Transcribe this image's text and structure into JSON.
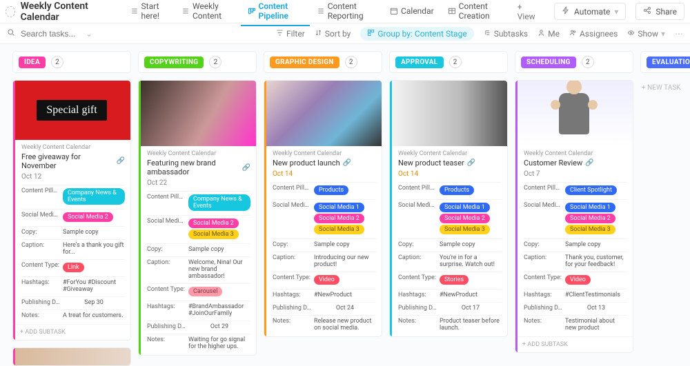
{
  "header": {
    "title": "Weekly Content Calendar",
    "views": [
      "Start here!",
      "Weekly Content",
      "Content Pipeline",
      "Content Reporting",
      "Calendar",
      "Content Creation"
    ],
    "add_view": "+ View",
    "automate": "Automate",
    "share": "Share"
  },
  "filterbar": {
    "search_placeholder": "Search tasks...",
    "filter": "Filter",
    "sort": "Sort by",
    "group": "Group by: Content Stage",
    "subtasks": "Subtasks",
    "me": "Me",
    "assignees": "Assignees",
    "show": "Show"
  },
  "colors": {
    "idea": "#ff3ea5",
    "copywriting": "#54d21a",
    "graphic": "#ff9a1f",
    "approval": "#17c7e0",
    "scheduling": "#b15cff",
    "evaluation": "#4a6cff",
    "pillar_news": "#17c7e0",
    "pillar_products": "#2f6af5",
    "pillar_spotlight": "#2f6af5",
    "sm1": "#2f6af5",
    "sm2": "#ff3ea5",
    "sm3": "#ffd11a",
    "link": "#ff4d64",
    "carousel": "#ff9aa8",
    "video": "#ff4d64",
    "stories": "#ff4d64"
  },
  "stages": [
    {
      "name": "IDEA",
      "color_key": "idea",
      "count": 2
    },
    {
      "name": "COPYWRITING",
      "color_key": "copywriting",
      "count": 2
    },
    {
      "name": "GRAPHIC DESIGN",
      "color_key": "graphic",
      "count": 2
    },
    {
      "name": "APPROVAL",
      "color_key": "approval",
      "count": 2
    },
    {
      "name": "SCHEDULING",
      "color_key": "scheduling",
      "count": 2
    },
    {
      "name": "EVALUATION",
      "color_key": "evaluation",
      "count": 0
    }
  ],
  "new_task": "+ NEW TASK",
  "add_subtask": "+ ADD SUBTASK",
  "category_label": "Weekly Content Calendar",
  "field_labels": {
    "pillar": "Content Pillar:",
    "social": "Social Media...",
    "copy": "Copy:",
    "caption": "Caption:",
    "ctype": "Content Type:",
    "hashtags": "Hashtags:",
    "pub": "Publishing D...",
    "notes": "Notes:"
  },
  "cards": {
    "c0": {
      "title": "Free giveaway for November",
      "date": "Oct 12",
      "pillar": "Company News & Events",
      "pillar_color": "pillar_news",
      "social": [
        "sm2"
      ],
      "social_labels": [
        "Social Media 2"
      ],
      "copy": "Sample copy",
      "caption": "Here's a thank you gift for...",
      "ctype": "Link",
      "ctype_color": "link",
      "hashtags": "#ForYou #Discount #Giveaway",
      "pub": "Sep 30",
      "notes": "A treat for customers."
    },
    "c1": {
      "title": "Featuring new brand ambassador",
      "date": "Oct 22",
      "pillar": "Company News & Events",
      "pillar_color": "pillar_news",
      "social": [
        "sm2",
        "sm3"
      ],
      "social_labels": [
        "Social Media 2",
        "Social Media 3"
      ],
      "copy": "Sample copy",
      "caption": "Welcome, Nina! Our new brand ambassador!",
      "ctype": "Carousel",
      "ctype_color": "carousel",
      "hashtags": "#BrandAmbassador #JoinOurFamily",
      "pub": "Oct 29",
      "notes": "Waiting for go signal for the higher ups."
    },
    "c2": {
      "title": "New product launch",
      "date": "Oct 14",
      "pillar": "Products",
      "pillar_color": "pillar_products",
      "social": [
        "sm1",
        "sm2",
        "sm3"
      ],
      "social_labels": [
        "Social Media 1",
        "Social Media 2",
        "Social Media 3"
      ],
      "copy": "Sample copy",
      "caption": "Introducing our new product!",
      "ctype": "Video",
      "ctype_color": "video",
      "hashtags": "#NewProduct",
      "pub": "Oct 24",
      "notes": "Release new product on social media."
    },
    "c3": {
      "title": "New product teaser",
      "date": "Oct 14",
      "pillar": "Products",
      "pillar_color": "pillar_products",
      "social": [
        "sm1",
        "sm2",
        "sm3"
      ],
      "social_labels": [
        "Social Media 1",
        "Social Media 2",
        "Social Media 3"
      ],
      "copy": "Sample copy",
      "caption": "You're in for a surprise. Watch out!",
      "ctype": "Stories",
      "ctype_color": "stories",
      "hashtags": "#NewProduct",
      "pub": "Oct 17",
      "notes": "Product teaser before launch."
    },
    "c4": {
      "title": "Customer Review",
      "date": "Oct 7",
      "pillar": "Client Spotlight",
      "pillar_color": "pillar_spotlight",
      "social": [
        "sm1",
        "sm2",
        "sm3"
      ],
      "social_labels": [
        "Social Media 1",
        "Social Media 2",
        "Social Media 3"
      ],
      "copy": "Sample copy",
      "caption": "Thank you, customer, for your feedback!",
      "ctype": "Video",
      "ctype_color": "video",
      "hashtags": "#ClientTestimonials",
      "pub": "Oct 13",
      "notes": "Testimonial about new product"
    }
  }
}
